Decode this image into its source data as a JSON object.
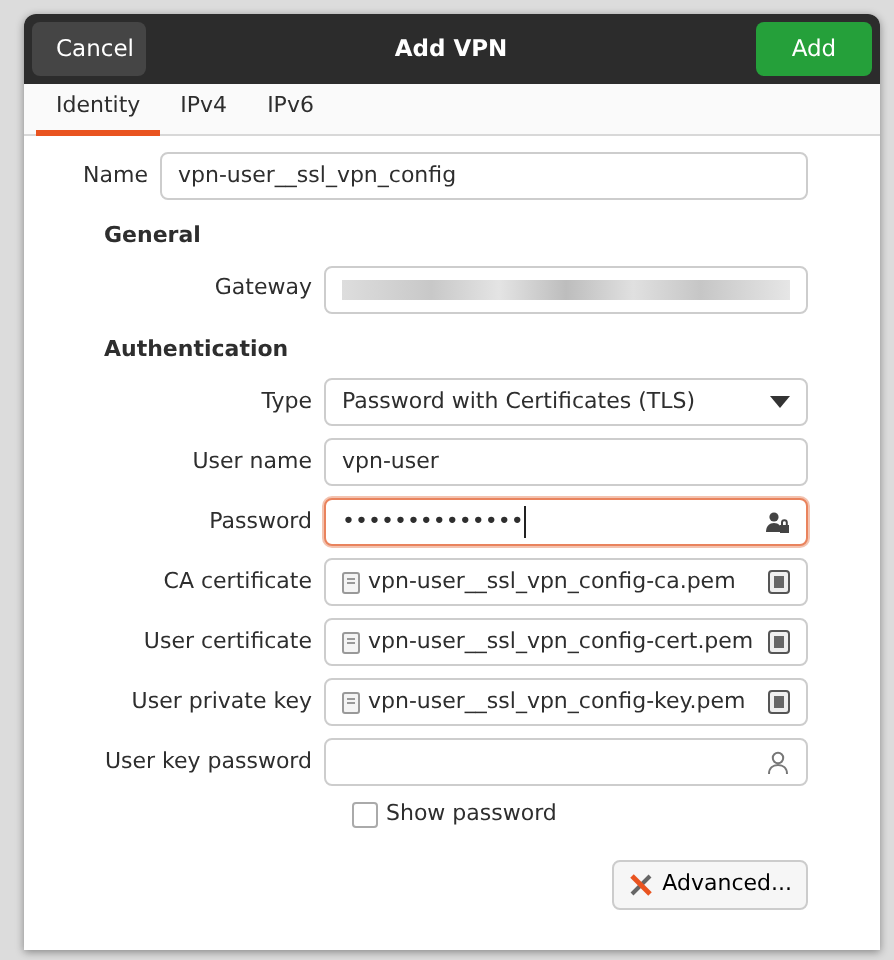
{
  "window": {
    "title": "Add VPN",
    "cancel": "Cancel",
    "confirm": "Add"
  },
  "tabs": [
    {
      "label": "Identity",
      "selected": true
    },
    {
      "label": "IPv4",
      "selected": false
    },
    {
      "label": "IPv6",
      "selected": false
    }
  ],
  "name": {
    "label": "Name",
    "value": "vpn-user__ssl_vpn_config"
  },
  "sections": [
    {
      "title": "General",
      "fields": [
        {
          "kind": "blurred",
          "label": "Gateway"
        }
      ]
    },
    {
      "title": "Authentication",
      "fields": [
        {
          "kind": "select",
          "label": "Type",
          "value": "Password with Certificates (TLS)"
        },
        {
          "kind": "text",
          "label": "User name",
          "value": "vpn-user",
          "focused": false
        },
        {
          "kind": "password",
          "label": "Password",
          "value": "••••••••••••••",
          "focused": true
        },
        {
          "kind": "file",
          "label": "CA certificate",
          "value": "vpn-user__ssl_vpn_config-ca.pem"
        },
        {
          "kind": "file",
          "label": "User certificate",
          "value": "vpn-user__ssl_vpn_config-cert.pem"
        },
        {
          "kind": "file",
          "label": "User private key",
          "value": "vpn-user__ssl_vpn_config-key.pem"
        },
        {
          "kind": "key_password",
          "label": "User key password",
          "focused": false
        }
      ]
    }
  ],
  "show_password": {
    "label": "Show password",
    "checked": false
  },
  "advanced": {
    "label": "Advanced..."
  }
}
